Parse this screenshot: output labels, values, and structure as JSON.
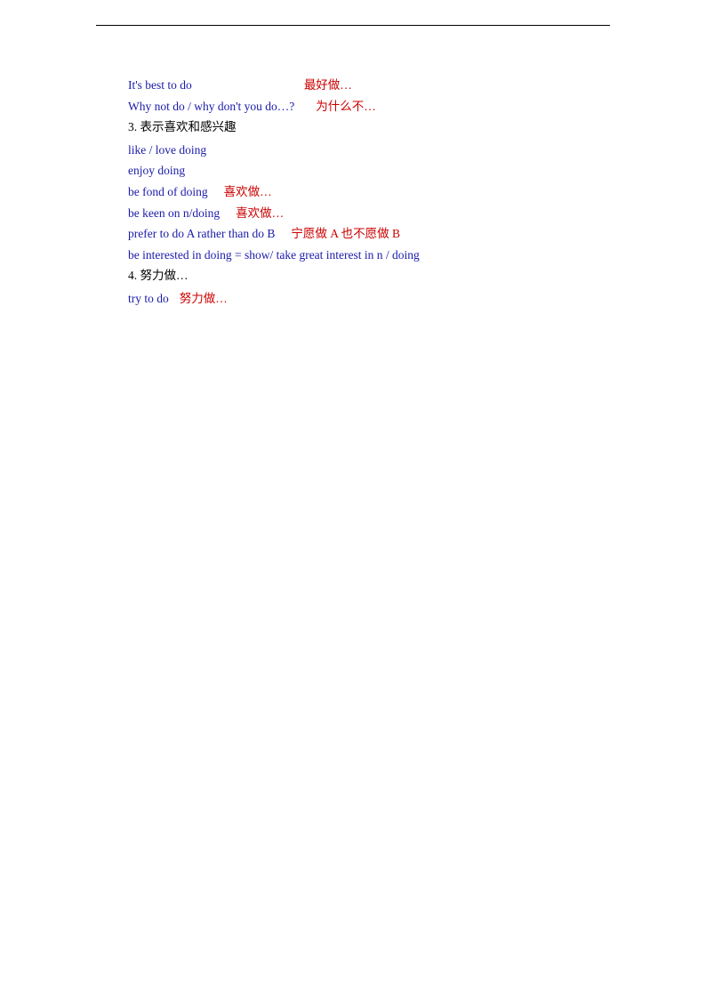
{
  "border": true,
  "lines": [
    {
      "type": "phrase",
      "english": "It's best to do",
      "spacing": "                    ",
      "chinese": "最好做…"
    },
    {
      "type": "phrase",
      "english": "Why not do / why don't you do…?",
      "spacing": "   ",
      "chinese": "为什么不…"
    },
    {
      "type": "header",
      "text": "3. 表示喜欢和感兴趣"
    },
    {
      "type": "phrase",
      "english": "like / love doing",
      "chinese": ""
    },
    {
      "type": "phrase",
      "english": "enjoy doing",
      "chinese": ""
    },
    {
      "type": "phrase",
      "english": "be fond of doing",
      "spacing": "   ",
      "chinese": "喜欢做…"
    },
    {
      "type": "phrase",
      "english": "be keen on n/doing",
      "spacing": "   ",
      "chinese": "喜欢做…"
    },
    {
      "type": "phrase",
      "english": "prefer to do A rather than do B",
      "spacing": "   ",
      "chinese": "宁愿做 A 也不愿做 B"
    },
    {
      "type": "phrase",
      "english": "be interested in doing = show/ take great interest in n / doing",
      "chinese": ""
    },
    {
      "type": "header",
      "text": "4.  努力做…"
    },
    {
      "type": "phrase",
      "english": "try to do",
      "spacing": " ",
      "chinese": "努力做…"
    }
  ]
}
